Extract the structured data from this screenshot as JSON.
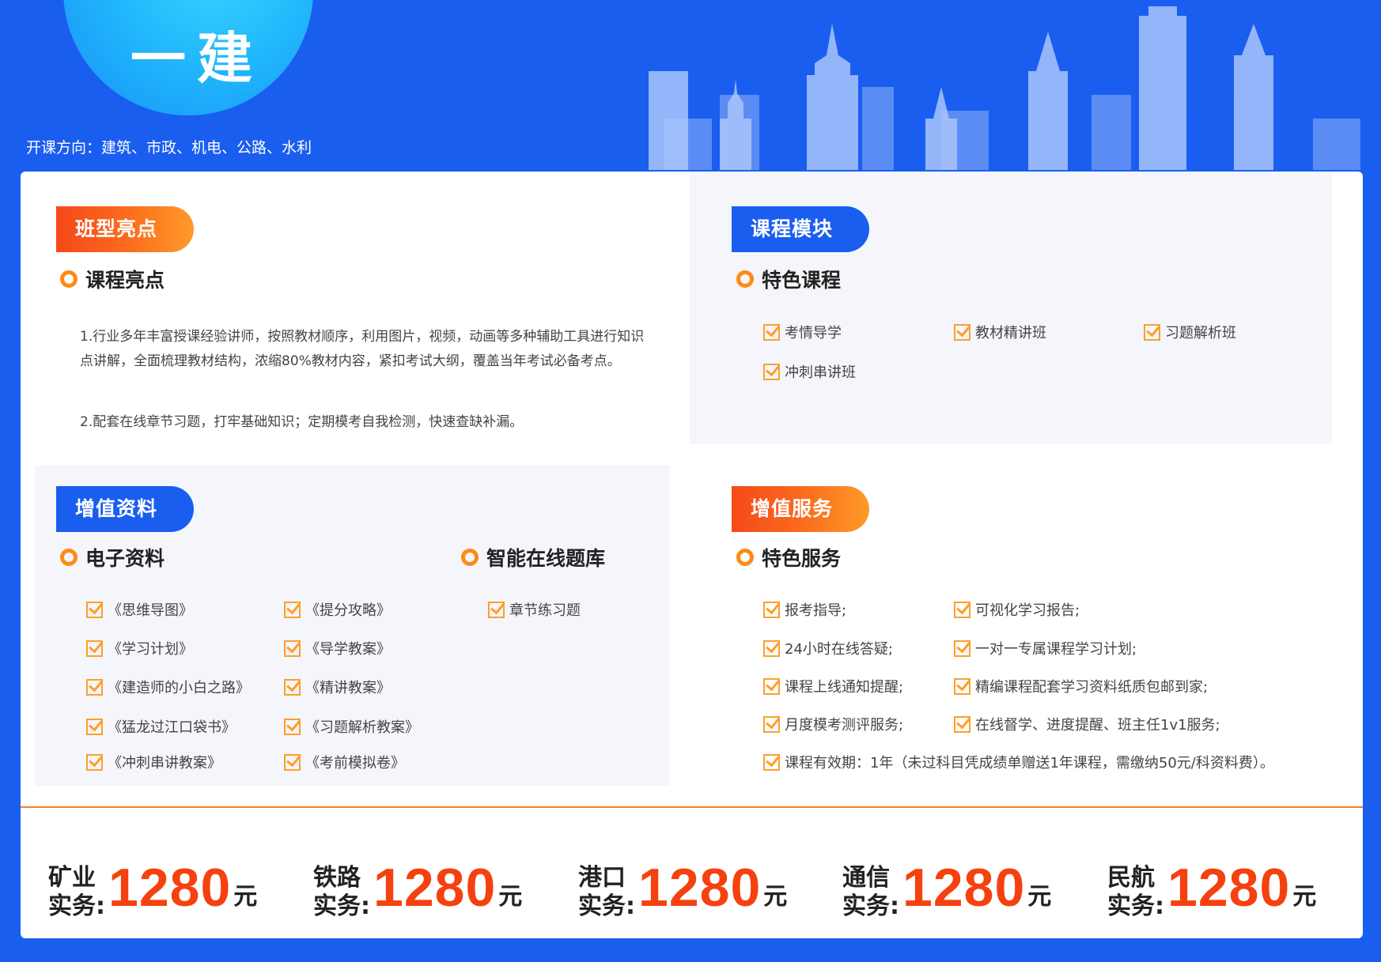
{
  "header": {
    "title": "一建",
    "subtitle": "开课方向：建筑、市政、机电、公路、水利"
  },
  "highlights": {
    "pill": "班型亮点",
    "heading": "课程亮点",
    "para1": "1.行业多年丰富授课经验讲师，按照教材顺序，利用图片，视频，动画等多种辅助工具进行知识点讲解，全面梳理教材结构，浓缩80%教材内容，紧扣考试大纲，覆盖当年考试必备考点。",
    "para2": "2.配套在线章节习题，打牢基础知识；定期模考自我检测，快速查缺补漏。"
  },
  "modules": {
    "pill": "课程模块",
    "heading": "特色课程",
    "items": [
      "考情导学",
      "教材精讲班",
      "习题解析班",
      "冲刺串讲班"
    ]
  },
  "materials": {
    "pill": "增值资料",
    "heading": "电子资料",
    "col1": [
      "《思维导图》",
      "《学习计划》",
      "《建造师的小白之路》",
      "《猛龙过江口袋书》",
      "《冲刺串讲教案》"
    ],
    "col2": [
      "《提分攻略》",
      "《导学教案》",
      "《精讲教案》",
      "《习题解析教案》",
      "《考前模拟卷》"
    ],
    "bank_heading": "智能在线题库",
    "bank_items": [
      "章节练习题"
    ]
  },
  "services": {
    "pill": "增值服务",
    "heading": "特色服务",
    "col1": [
      "报考指导;",
      "24小时在线答疑;",
      "课程上线通知提醒;",
      "月度模考测评服务;"
    ],
    "col2": [
      "可视化学习报告;",
      "一对一专属课程学习计划;",
      "精编课程配套学习资料纸质包邮到家;",
      "在线督学、进度提醒、班主任1v1服务;"
    ],
    "validity": "课程有效期：1年（未过科目凭成绩单赠送1年课程，需缴纳50元/科资料费）。"
  },
  "prices": [
    {
      "line1": "矿业",
      "line2": "实务:",
      "amount": "1280",
      "unit": "元"
    },
    {
      "line1": "铁路",
      "line2": "实务:",
      "amount": "1280",
      "unit": "元"
    },
    {
      "line1": "港口",
      "line2": "实务:",
      "amount": "1280",
      "unit": "元"
    },
    {
      "line1": "通信",
      "line2": "实务:",
      "amount": "1280",
      "unit": "元"
    },
    {
      "line1": "民航",
      "line2": "实务:",
      "amount": "1280",
      "unit": "元"
    }
  ],
  "colors": {
    "brand_blue": "#1a5ef0",
    "accent_orange": "#f5410f",
    "check_orange": "#ff9e2a"
  }
}
